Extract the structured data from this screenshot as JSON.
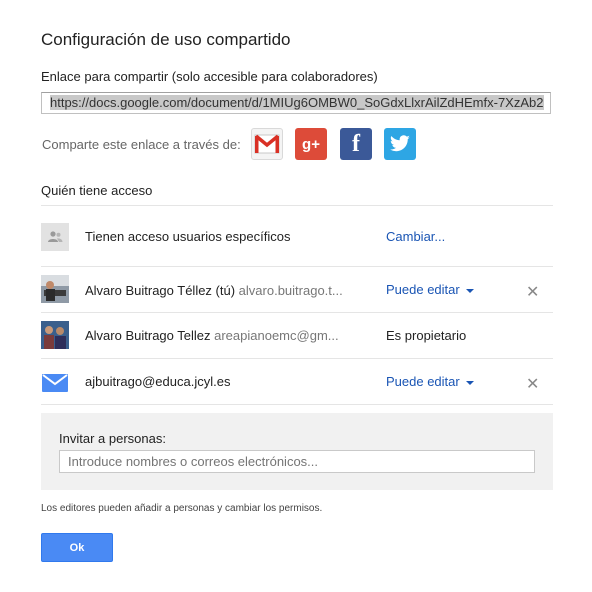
{
  "dialog": {
    "title": "Configuración de uso compartido",
    "link_label": "Enlace para compartir (solo accesible para colaboradores)",
    "link_value": "https://docs.google.com/document/d/1MIUg6OMBW0_SoGdxLlxrAilZdHEmfx-7XzAb2",
    "share_via_label": "Comparte este enlace a través de:",
    "share_icons": [
      "gmail-icon",
      "google-plus-icon",
      "facebook-icon",
      "twitter-icon"
    ],
    "access_title": "Quién tiene acceso",
    "visibility": {
      "text": "Tienen acceso usuarios específicos",
      "change_link": "Cambiar..."
    },
    "people": [
      {
        "name": "Alvaro Buitrago Téllez (tú)",
        "email": "alvaro.buitrago.t...",
        "role": "Puede editar",
        "removable": true
      },
      {
        "name": "Alvaro Buitrago Tellez",
        "email": "areapianoemc@gm...",
        "role": "Es propietario",
        "removable": false
      },
      {
        "name": "ajbuitrago@educa.jcyl.es",
        "email": "",
        "role": "Puede editar",
        "removable": true
      }
    ],
    "invite": {
      "label": "Invitar a personas:",
      "placeholder": "Introduce nombres o correos electrónicos..."
    },
    "note": "Los editores pueden añadir a personas y cambiar los permisos.",
    "ok_label": "Ok"
  },
  "colors": {
    "link_blue": "#1a55b4",
    "button_blue": "#4a8af4",
    "gplus_red": "#dd4b39",
    "facebook_blue": "#3b5998",
    "twitter_blue": "#2ea6e4"
  }
}
